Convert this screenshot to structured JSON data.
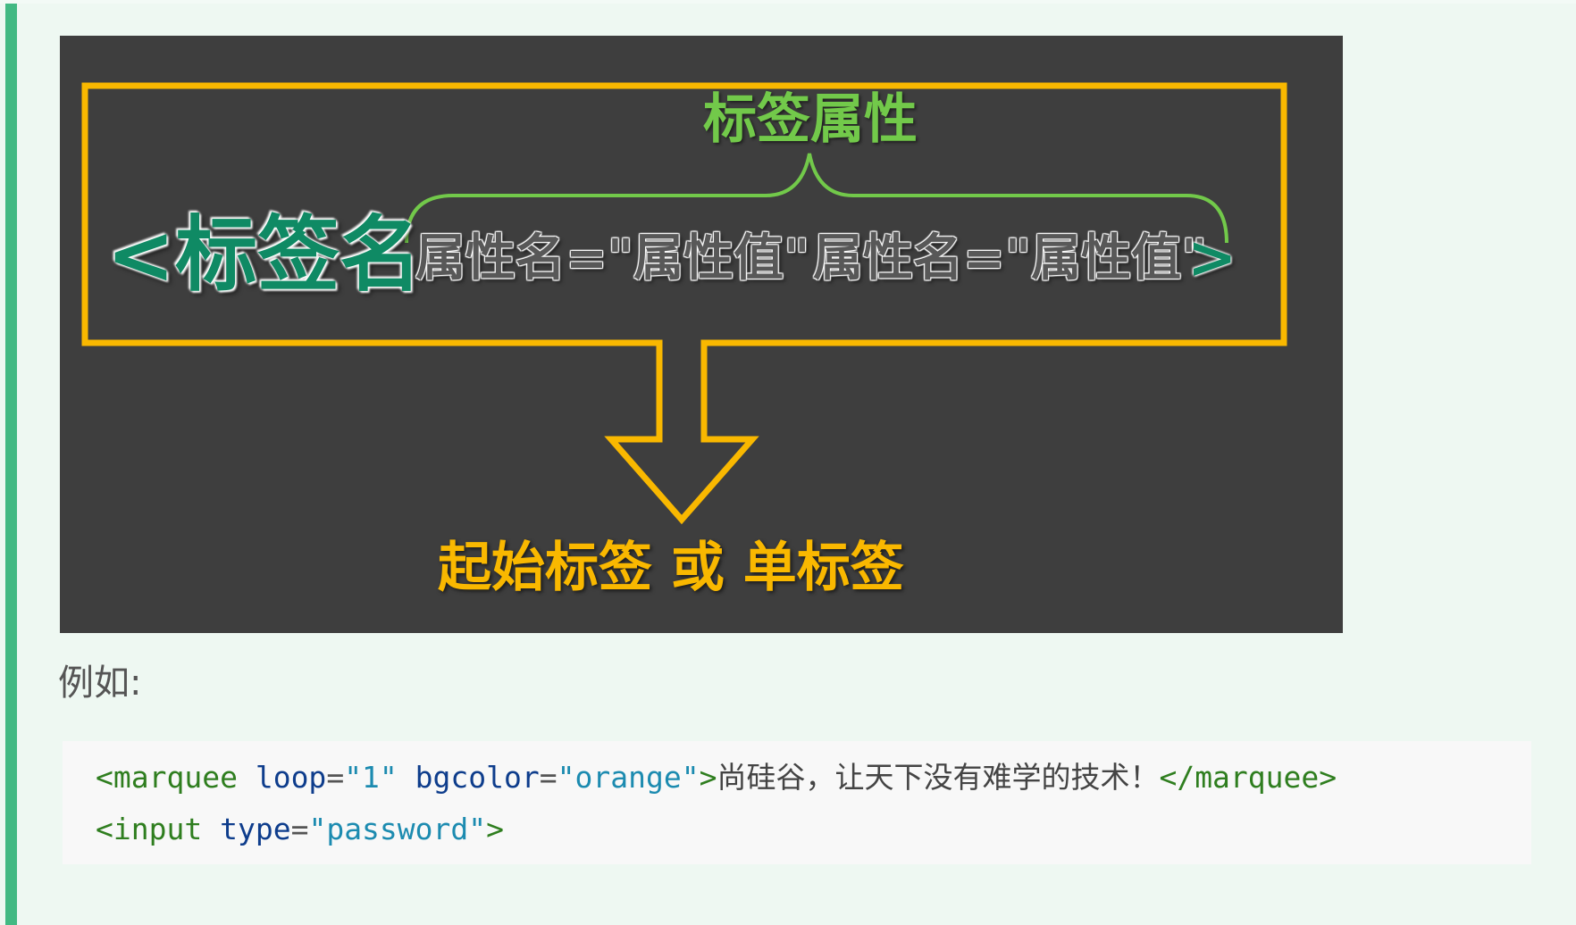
{
  "diagram": {
    "attr_title": "标签属性",
    "tag_open": "<标签名",
    "attr_pair_1": "属性名=\"属性值\"",
    "attr_pair_2": "属性名=\"属性值\"",
    "tag_close": ">",
    "caption": "起始标签 或 单标签",
    "colors": {
      "background": "#3e3e3e",
      "frame": "#f9b800",
      "brace": "#72c94a",
      "tag": "#0f8a64"
    }
  },
  "example_label": "例如:",
  "code": {
    "line1": {
      "open_tag": "<marquee",
      "attr1": "loop",
      "eq1": "=",
      "val1": "\"1\"",
      "attr2": "bgcolor",
      "eq2": "=",
      "val2": "\"orange\"",
      "gt": ">",
      "text": "尚硅谷，让天下没有难学的技术！",
      "close_tag": "</marquee>"
    },
    "line2": {
      "open_tag": "<input",
      "attr1": "type",
      "eq1": "=",
      "val1": "\"password\"",
      "gt": ">"
    }
  },
  "accent_color": "#42b983"
}
